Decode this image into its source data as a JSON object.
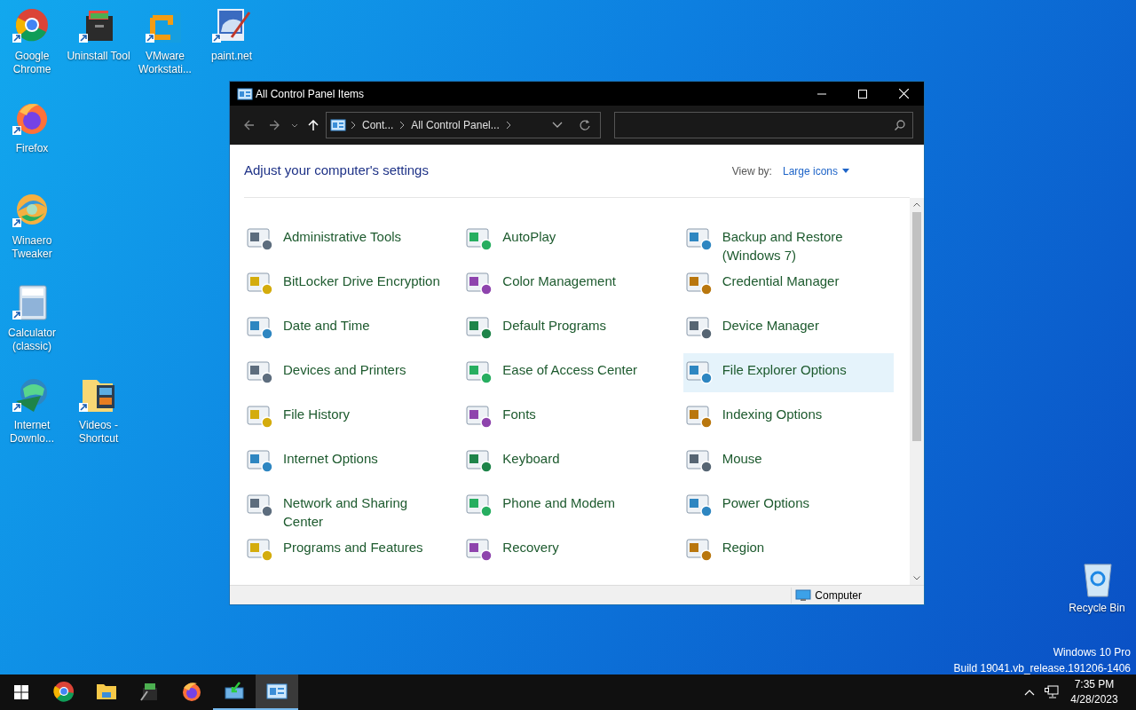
{
  "desktop_icons": [
    {
      "label": "Google Chrome"
    },
    {
      "label": "Uninstall Tool"
    },
    {
      "label": "VMware Workstati..."
    },
    {
      "label": "paint.net"
    },
    {
      "label": "Firefox"
    },
    {
      "label": "Winaero Tweaker"
    },
    {
      "label": "Calculator (classic)"
    },
    {
      "label": "Internet Downlo..."
    },
    {
      "label": "Videos - Shortcut"
    },
    {
      "label": "Recycle Bin"
    }
  ],
  "window": {
    "title": "All Control Panel Items",
    "address": [
      "Cont...",
      "All Control Panel..."
    ],
    "heading": "Adjust your computer's settings",
    "view_by": {
      "label": "View by:",
      "value": "Large icons"
    },
    "items": [
      {
        "label": "Administrative Tools",
        "highlighted": false
      },
      {
        "label": "AutoPlay",
        "highlighted": false
      },
      {
        "label": "Backup and Restore (Windows 7)",
        "highlighted": false
      },
      {
        "label": "BitLocker Drive Encryption",
        "highlighted": false
      },
      {
        "label": "Color Management",
        "highlighted": false
      },
      {
        "label": "Credential Manager",
        "highlighted": false
      },
      {
        "label": "Date and Time",
        "highlighted": false
      },
      {
        "label": "Default Programs",
        "highlighted": false
      },
      {
        "label": "Device Manager",
        "highlighted": false
      },
      {
        "label": "Devices and Printers",
        "highlighted": false
      },
      {
        "label": "Ease of Access Center",
        "highlighted": false
      },
      {
        "label": "File Explorer Options",
        "highlighted": true
      },
      {
        "label": "File History",
        "highlighted": false
      },
      {
        "label": "Fonts",
        "highlighted": false
      },
      {
        "label": "Indexing Options",
        "highlighted": false
      },
      {
        "label": "Internet Options",
        "highlighted": false
      },
      {
        "label": "Keyboard",
        "highlighted": false
      },
      {
        "label": "Mouse",
        "highlighted": false
      },
      {
        "label": "Network and Sharing Center",
        "highlighted": false
      },
      {
        "label": "Phone and Modem",
        "highlighted": false
      },
      {
        "label": "Power Options",
        "highlighted": false
      },
      {
        "label": "Programs and Features",
        "highlighted": false
      },
      {
        "label": "Recovery",
        "highlighted": false
      },
      {
        "label": "Region",
        "highlighted": false
      }
    ],
    "status_bar": {
      "location": "Computer"
    }
  },
  "watermark": [
    "Windows 10 Pro",
    "Build 19041.vb_release.191206-1406"
  ],
  "taskbar": {
    "apps": [
      {
        "running": false,
        "active": false
      },
      {
        "running": false,
        "active": false
      },
      {
        "running": false,
        "active": false
      },
      {
        "running": false,
        "active": false
      },
      {
        "running": true,
        "active": false
      },
      {
        "running": true,
        "active": true
      }
    ],
    "time": "7:35 PM",
    "date": "4/28/2023"
  }
}
